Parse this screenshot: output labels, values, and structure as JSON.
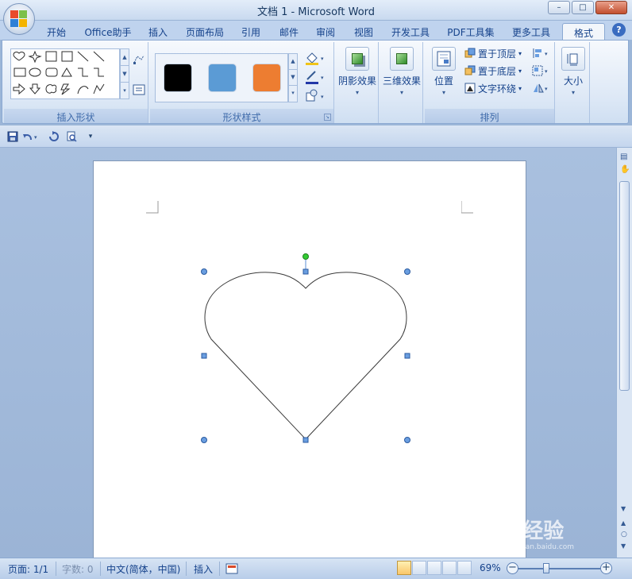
{
  "window": {
    "title": "文档 1 - Microsoft Word",
    "minimize": "–",
    "maximize": "□",
    "close": "✕"
  },
  "tabs": [
    {
      "label": "开始"
    },
    {
      "label": "Office助手"
    },
    {
      "label": "插入"
    },
    {
      "label": "页面布局"
    },
    {
      "label": "引用"
    },
    {
      "label": "邮件"
    },
    {
      "label": "审阅"
    },
    {
      "label": "视图"
    },
    {
      "label": "开发工具"
    },
    {
      "label": "PDF工具集"
    },
    {
      "label": "更多工具"
    },
    {
      "label": "格式",
      "active": true
    }
  ],
  "help": "?",
  "ribbon": {
    "insert_shapes": {
      "label": "插入形状"
    },
    "shape_styles": {
      "label": "形状样式",
      "swatches": [
        "#000000",
        "#5b9bd5",
        "#ed7d31"
      ]
    },
    "shadow_effects": {
      "label": "阴影效果"
    },
    "three_d_effects": {
      "label": "三维效果"
    },
    "arrange": {
      "label": "排列",
      "position": "位置",
      "bring_to_front": "置于顶层",
      "send_to_back": "置于底层",
      "text_wrapping": "文字环绕"
    },
    "size": {
      "label": "大小"
    }
  },
  "statusbar": {
    "page": "页面: 1/1",
    "words": "字数: 0",
    "language": "中文(简体，中国)",
    "mode": "插入",
    "zoom": "69%"
  },
  "watermark": {
    "brand": "Bai经验",
    "url": "jingyan.baidu.com"
  },
  "colors": {
    "handle": "#5b8fd6",
    "rotate_handle": "#33cc33",
    "accent": "#15428b"
  }
}
